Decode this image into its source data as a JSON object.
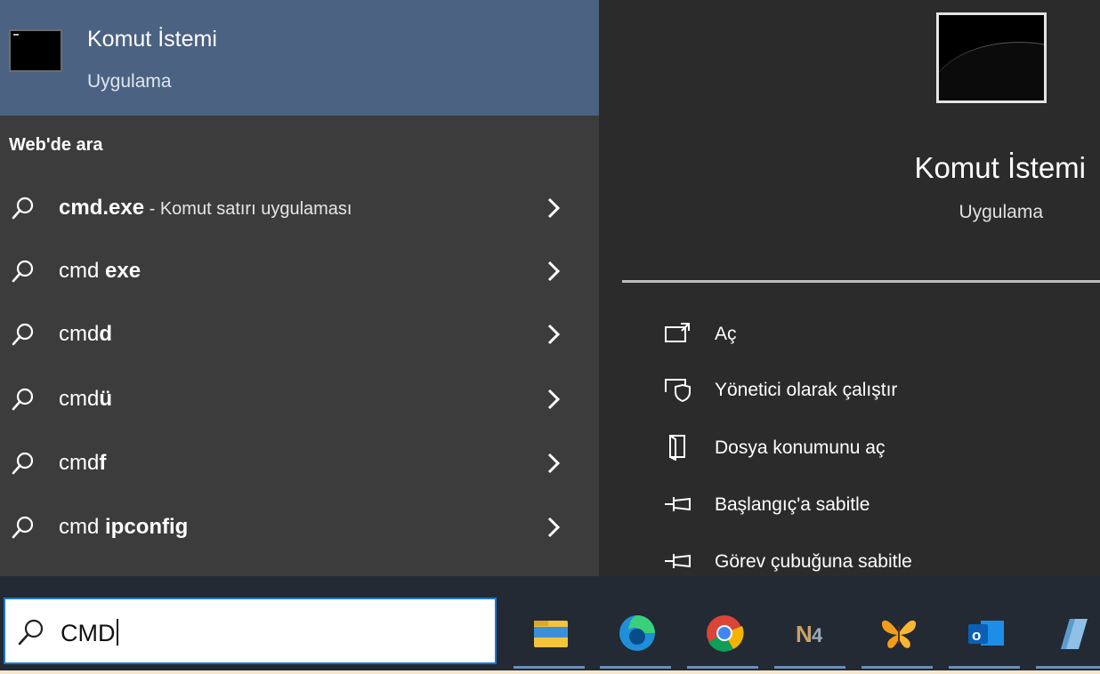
{
  "best_match": {
    "title": "Komut İstemi",
    "subtitle": "Uygulama"
  },
  "web_section": {
    "label": "Web'de ara"
  },
  "results": [
    {
      "prefix": "cmd.exe",
      "bold": "",
      "suffix": " - Komut satırı uygulaması"
    },
    {
      "prefix": "cmd ",
      "bold": "exe",
      "suffix": ""
    },
    {
      "prefix": "cmd",
      "bold": "d",
      "suffix": ""
    },
    {
      "prefix": "cmd",
      "bold": "ü",
      "suffix": ""
    },
    {
      "prefix": "cmd",
      "bold": "f",
      "suffix": ""
    },
    {
      "prefix": "cmd ",
      "bold": "ipconfig",
      "suffix": ""
    }
  ],
  "preview": {
    "title": "Komut İstemi",
    "subtitle": "Uygulama"
  },
  "actions": [
    {
      "label": "Aç",
      "icon": "open-icon"
    },
    {
      "label": "Yönetici olarak çalıştır",
      "icon": "run-as-admin-icon"
    },
    {
      "label": "Dosya konumunu aç",
      "icon": "file-location-icon"
    },
    {
      "label": "Başlangıç'a sabitle",
      "icon": "pin-icon"
    },
    {
      "label": "Görev çubuğuna sabitle",
      "icon": "pin-icon"
    }
  ],
  "search": {
    "value": "CMD"
  },
  "taskbar_apps": [
    "file-explorer",
    "edge",
    "chrome",
    "n4",
    "butterfly-app",
    "outlook",
    "notepad"
  ],
  "colors": {
    "accent": "#1a78d2",
    "best_match_bg": "#4b6282",
    "panel_bg": "#3c3c3c"
  }
}
